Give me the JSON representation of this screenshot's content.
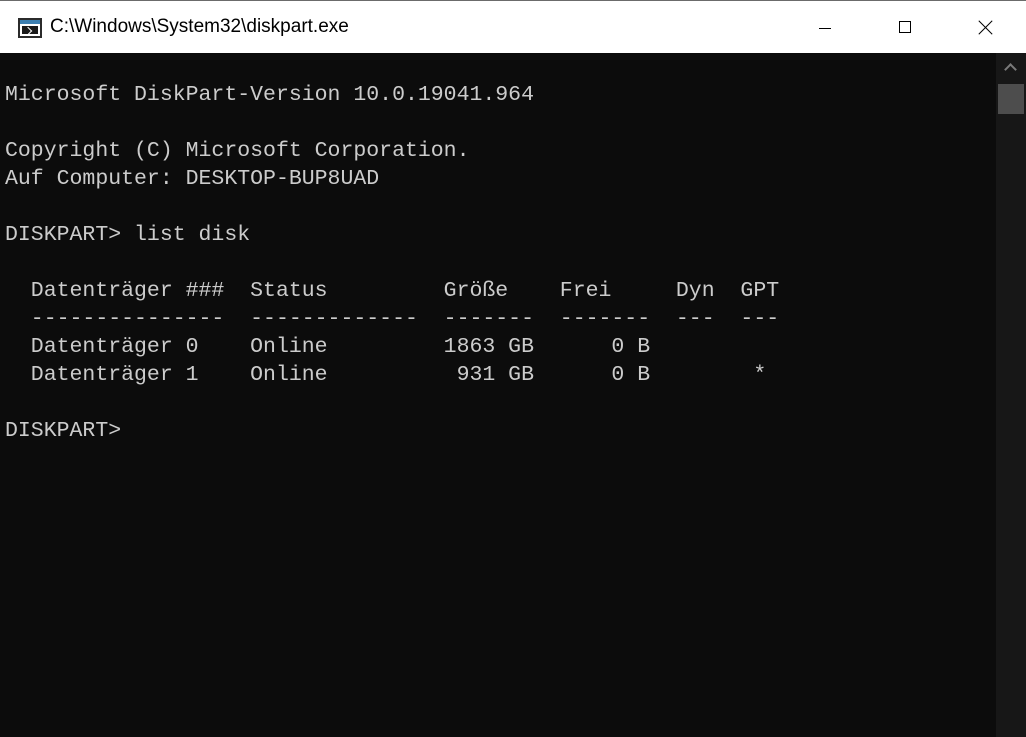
{
  "window": {
    "title": "C:\\Windows\\System32\\diskpart.exe",
    "icon": "console-app-icon",
    "controls": [
      "minimize-icon",
      "maximize-icon",
      "close-icon"
    ]
  },
  "console": {
    "lines": [
      "",
      "Microsoft DiskPart-Version 10.0.19041.964",
      "",
      "Copyright (C) Microsoft Corporation.",
      "Auf Computer: DESKTOP-BUP8UAD",
      "",
      "DISKPART> list disk",
      "",
      "  Datenträger ###  Status         Größe    Frei     Dyn  GPT",
      "  ---------------  -------------  -------  -------  ---  ---",
      "  Datenträger 0    Online         1863 GB      0 B",
      "  Datenträger 1    Online          931 GB      0 B        *",
      "",
      "DISKPART> "
    ]
  },
  "colors": {
    "console_background": "#0c0c0c",
    "console_text": "#cccccc",
    "titlebar": "#ffffff"
  }
}
